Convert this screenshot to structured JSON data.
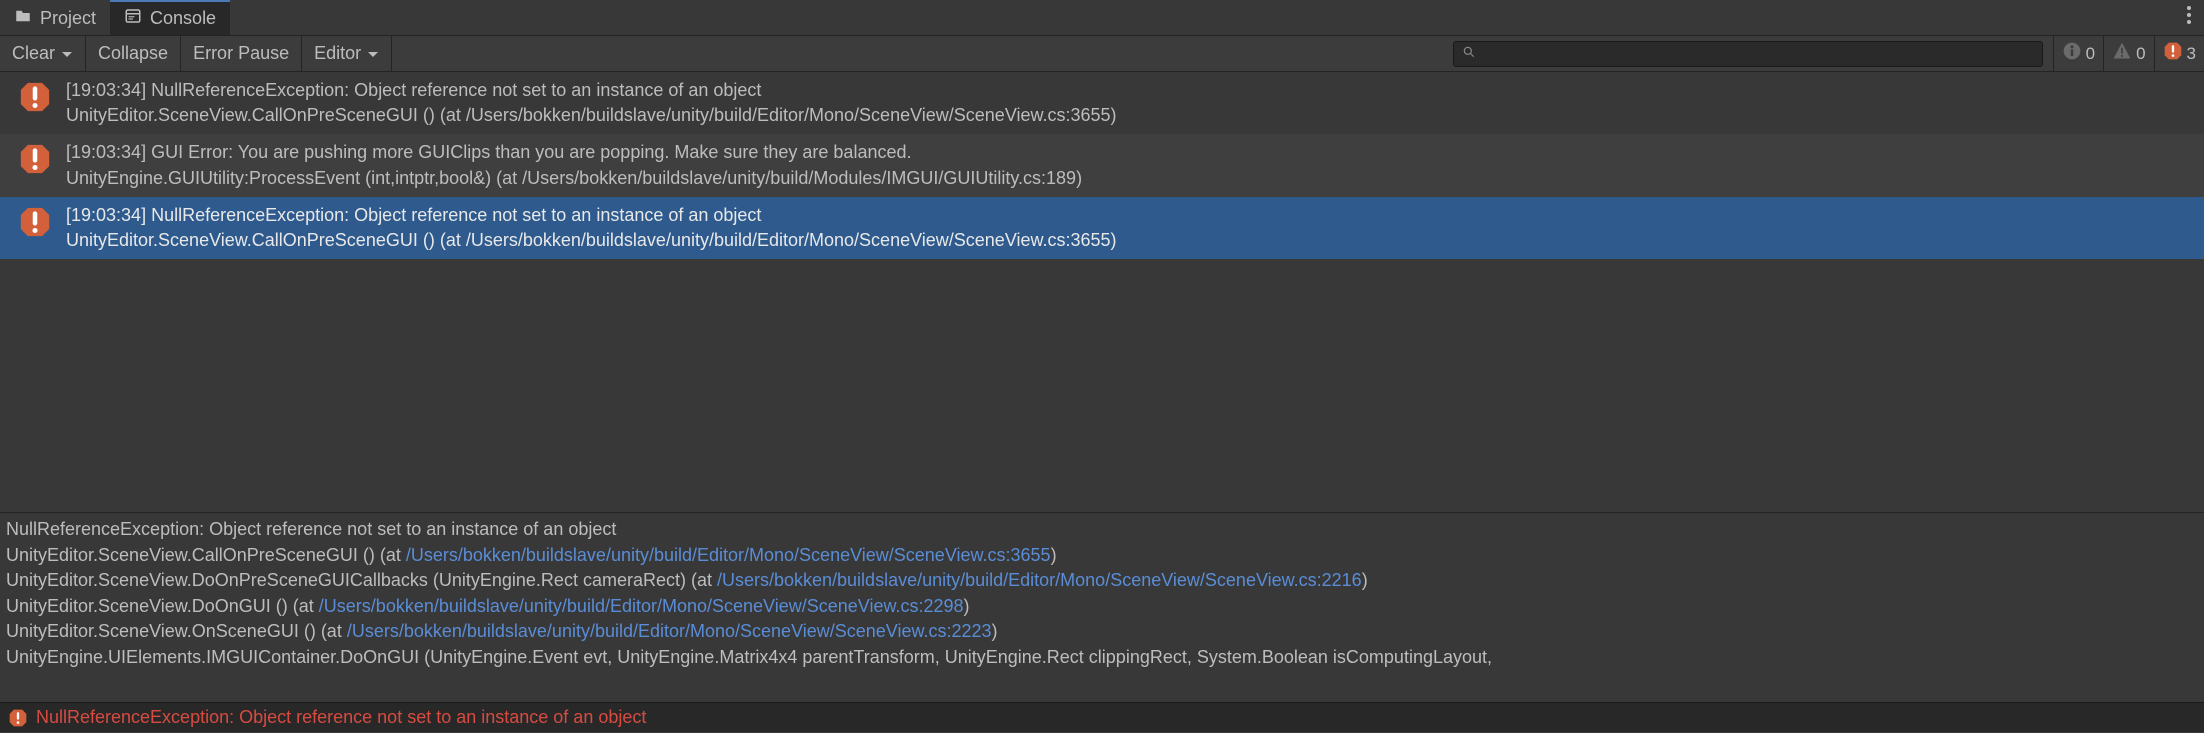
{
  "tabs": {
    "project": "Project",
    "console": "Console"
  },
  "toolbar": {
    "clear": "Clear",
    "collapse": "Collapse",
    "error_pause": "Error Pause",
    "editor": "Editor"
  },
  "search": {
    "placeholder": ""
  },
  "badges": {
    "info_count": "0",
    "warn_count": "0",
    "error_count": "3"
  },
  "logs": [
    {
      "line1": "[19:03:34] NullReferenceException: Object reference not set to an instance of an object",
      "line2": "UnityEditor.SceneView.CallOnPreSceneGUI () (at /Users/bokken/buildslave/unity/build/Editor/Mono/SceneView/SceneView.cs:3655)"
    },
    {
      "line1": "[19:03:34] GUI Error: You are pushing more GUIClips than you are popping. Make sure they are balanced.",
      "line2": "UnityEngine.GUIUtility:ProcessEvent (int,intptr,bool&) (at /Users/bokken/buildslave/unity/build/Modules/IMGUI/GUIUtility.cs:189)"
    },
    {
      "line1": "[19:03:34] NullReferenceException: Object reference not set to an instance of an object",
      "line2": "UnityEditor.SceneView.CallOnPreSceneGUI () (at /Users/bokken/buildslave/unity/build/Editor/Mono/SceneView/SceneView.cs:3655)"
    }
  ],
  "detail": {
    "line0": "NullReferenceException: Object reference not set to an instance of an object",
    "line1_pre": "UnityEditor.SceneView.CallOnPreSceneGUI () (at ",
    "line1_path": "/Users/bokken/buildslave/unity/build/Editor/Mono/SceneView/SceneView.cs:3655",
    "line1_post": ")",
    "line2_pre": "UnityEditor.SceneView.DoOnPreSceneGUICallbacks (UnityEngine.Rect cameraRect) (at ",
    "line2_path": "/Users/bokken/buildslave/unity/build/Editor/Mono/SceneView/SceneView.cs:2216",
    "line2_post": ")",
    "line3_pre": "UnityEditor.SceneView.DoOnGUI () (at ",
    "line3_path": "/Users/bokken/buildslave/unity/build/Editor/Mono/SceneView/SceneView.cs:2298",
    "line3_post": ")",
    "line4_pre": "UnityEditor.SceneView.OnSceneGUI () (at ",
    "line4_path": "/Users/bokken/buildslave/unity/build/Editor/Mono/SceneView/SceneView.cs:2223",
    "line4_post": ")",
    "line5": "UnityEngine.UIElements.IMGUIContainer.DoOnGUI (UnityEngine.Event evt, UnityEngine.Matrix4x4 parentTransform, UnityEngine.Rect clippingRect, System.Boolean isComputingLayout,"
  },
  "status": {
    "message": "NullReferenceException: Object reference not set to an instance of an object"
  }
}
